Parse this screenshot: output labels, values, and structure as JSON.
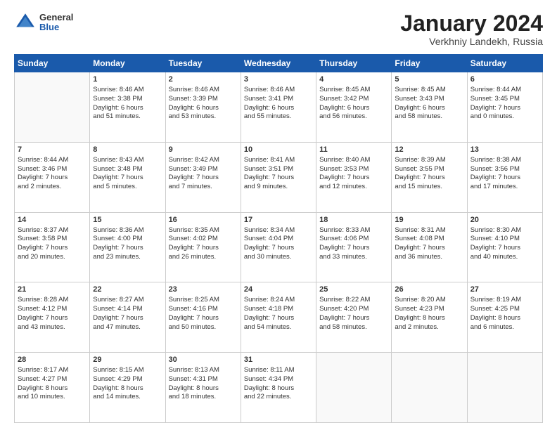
{
  "header": {
    "logo": {
      "general": "General",
      "blue": "Blue"
    },
    "title": "January 2024",
    "location": "Verkhniy Landekh, Russia"
  },
  "weekdays": [
    "Sunday",
    "Monday",
    "Tuesday",
    "Wednesday",
    "Thursday",
    "Friday",
    "Saturday"
  ],
  "weeks": [
    [
      {
        "day": "",
        "info": ""
      },
      {
        "day": "1",
        "info": "Sunrise: 8:46 AM\nSunset: 3:38 PM\nDaylight: 6 hours\nand 51 minutes."
      },
      {
        "day": "2",
        "info": "Sunrise: 8:46 AM\nSunset: 3:39 PM\nDaylight: 6 hours\nand 53 minutes."
      },
      {
        "day": "3",
        "info": "Sunrise: 8:46 AM\nSunset: 3:41 PM\nDaylight: 6 hours\nand 55 minutes."
      },
      {
        "day": "4",
        "info": "Sunrise: 8:45 AM\nSunset: 3:42 PM\nDaylight: 6 hours\nand 56 minutes."
      },
      {
        "day": "5",
        "info": "Sunrise: 8:45 AM\nSunset: 3:43 PM\nDaylight: 6 hours\nand 58 minutes."
      },
      {
        "day": "6",
        "info": "Sunrise: 8:44 AM\nSunset: 3:45 PM\nDaylight: 7 hours\nand 0 minutes."
      }
    ],
    [
      {
        "day": "7",
        "info": "Sunrise: 8:44 AM\nSunset: 3:46 PM\nDaylight: 7 hours\nand 2 minutes."
      },
      {
        "day": "8",
        "info": "Sunrise: 8:43 AM\nSunset: 3:48 PM\nDaylight: 7 hours\nand 5 minutes."
      },
      {
        "day": "9",
        "info": "Sunrise: 8:42 AM\nSunset: 3:49 PM\nDaylight: 7 hours\nand 7 minutes."
      },
      {
        "day": "10",
        "info": "Sunrise: 8:41 AM\nSunset: 3:51 PM\nDaylight: 7 hours\nand 9 minutes."
      },
      {
        "day": "11",
        "info": "Sunrise: 8:40 AM\nSunset: 3:53 PM\nDaylight: 7 hours\nand 12 minutes."
      },
      {
        "day": "12",
        "info": "Sunrise: 8:39 AM\nSunset: 3:55 PM\nDaylight: 7 hours\nand 15 minutes."
      },
      {
        "day": "13",
        "info": "Sunrise: 8:38 AM\nSunset: 3:56 PM\nDaylight: 7 hours\nand 17 minutes."
      }
    ],
    [
      {
        "day": "14",
        "info": "Sunrise: 8:37 AM\nSunset: 3:58 PM\nDaylight: 7 hours\nand 20 minutes."
      },
      {
        "day": "15",
        "info": "Sunrise: 8:36 AM\nSunset: 4:00 PM\nDaylight: 7 hours\nand 23 minutes."
      },
      {
        "day": "16",
        "info": "Sunrise: 8:35 AM\nSunset: 4:02 PM\nDaylight: 7 hours\nand 26 minutes."
      },
      {
        "day": "17",
        "info": "Sunrise: 8:34 AM\nSunset: 4:04 PM\nDaylight: 7 hours\nand 30 minutes."
      },
      {
        "day": "18",
        "info": "Sunrise: 8:33 AM\nSunset: 4:06 PM\nDaylight: 7 hours\nand 33 minutes."
      },
      {
        "day": "19",
        "info": "Sunrise: 8:31 AM\nSunset: 4:08 PM\nDaylight: 7 hours\nand 36 minutes."
      },
      {
        "day": "20",
        "info": "Sunrise: 8:30 AM\nSunset: 4:10 PM\nDaylight: 7 hours\nand 40 minutes."
      }
    ],
    [
      {
        "day": "21",
        "info": "Sunrise: 8:28 AM\nSunset: 4:12 PM\nDaylight: 7 hours\nand 43 minutes."
      },
      {
        "day": "22",
        "info": "Sunrise: 8:27 AM\nSunset: 4:14 PM\nDaylight: 7 hours\nand 47 minutes."
      },
      {
        "day": "23",
        "info": "Sunrise: 8:25 AM\nSunset: 4:16 PM\nDaylight: 7 hours\nand 50 minutes."
      },
      {
        "day": "24",
        "info": "Sunrise: 8:24 AM\nSunset: 4:18 PM\nDaylight: 7 hours\nand 54 minutes."
      },
      {
        "day": "25",
        "info": "Sunrise: 8:22 AM\nSunset: 4:20 PM\nDaylight: 7 hours\nand 58 minutes."
      },
      {
        "day": "26",
        "info": "Sunrise: 8:20 AM\nSunset: 4:23 PM\nDaylight: 8 hours\nand 2 minutes."
      },
      {
        "day": "27",
        "info": "Sunrise: 8:19 AM\nSunset: 4:25 PM\nDaylight: 8 hours\nand 6 minutes."
      }
    ],
    [
      {
        "day": "28",
        "info": "Sunrise: 8:17 AM\nSunset: 4:27 PM\nDaylight: 8 hours\nand 10 minutes."
      },
      {
        "day": "29",
        "info": "Sunrise: 8:15 AM\nSunset: 4:29 PM\nDaylight: 8 hours\nand 14 minutes."
      },
      {
        "day": "30",
        "info": "Sunrise: 8:13 AM\nSunset: 4:31 PM\nDaylight: 8 hours\nand 18 minutes."
      },
      {
        "day": "31",
        "info": "Sunrise: 8:11 AM\nSunset: 4:34 PM\nDaylight: 8 hours\nand 22 minutes."
      },
      {
        "day": "",
        "info": ""
      },
      {
        "day": "",
        "info": ""
      },
      {
        "day": "",
        "info": ""
      }
    ]
  ]
}
